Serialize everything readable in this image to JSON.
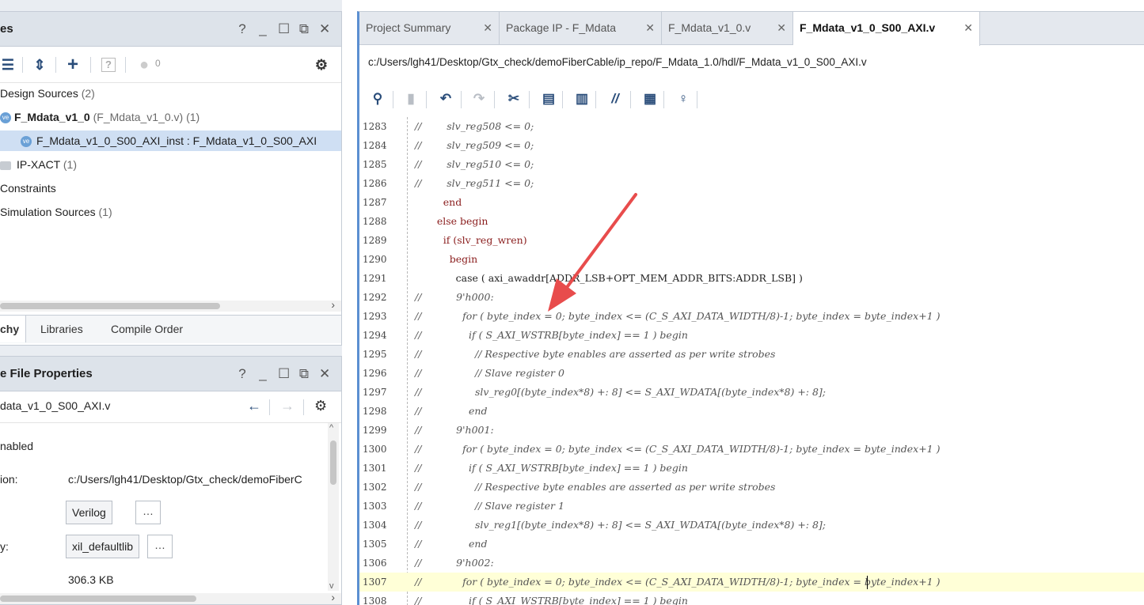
{
  "sources_panel": {
    "title": "es",
    "toolbar_badge": "0",
    "tree": [
      {
        "label": "Design Sources",
        "count": "(2)"
      },
      {
        "label": "F_Mdata_v1_0",
        "detail": "(F_Mdata_v1_0.v) (1)"
      },
      {
        "label": "F_Mdata_v1_0_S00_AXI_inst : F_Mdata_v1_0_S00_AXI"
      },
      {
        "label": "IP-XACT",
        "count": "(1)"
      },
      {
        "label": "Constraints"
      },
      {
        "label": "Simulation Sources",
        "count": "(1)"
      }
    ],
    "tabs": [
      "chy",
      "Libraries",
      "Compile Order"
    ]
  },
  "props_panel": {
    "title": "e File Properties",
    "file": "data_v1_0_S00_AXI.v",
    "enabled": "nabled",
    "location_label": "ion:",
    "location_value": "c:/Users/lgh41/Desktop/Gtx_check/demoFiberC",
    "type_value": "Verilog",
    "library_label": "y:",
    "library_value": "xil_defaultlib",
    "size_value": "306.3 KB"
  },
  "editor": {
    "tabs": [
      {
        "label": "Project Summary"
      },
      {
        "label": "Package IP - F_Mdata"
      },
      {
        "label": "F_Mdata_v1_0.v"
      },
      {
        "label": "F_Mdata_v1_0_S00_AXI.v"
      }
    ],
    "path": "c:/Users/lgh41/Desktop/Gtx_check/demoFiberCable/ip_repo/F_Mdata_1.0/hdl/F_Mdata_v1_0_S00_AXI.v",
    "lines": [
      {
        "n": "1283",
        "c": "//",
        "t": "        slv_reg508 <= 0;"
      },
      {
        "n": "1284",
        "c": "//",
        "t": "        slv_reg509 <= 0;"
      },
      {
        "n": "1285",
        "c": "//",
        "t": "        slv_reg510 <= 0;"
      },
      {
        "n": "1286",
        "c": "//",
        "t": "        slv_reg511 <= 0;"
      },
      {
        "n": "1287",
        "c": "",
        "t": "         end"
      },
      {
        "n": "1288",
        "c": "",
        "t": "       else begin"
      },
      {
        "n": "1289",
        "c": "",
        "t": "         if (slv_reg_wren)"
      },
      {
        "n": "1290",
        "c": "",
        "t": "           begin"
      },
      {
        "n": "1291",
        "c": "",
        "t": "             case ( axi_awaddr[ADDR_LSB+OPT_MEM_ADDR_BITS:ADDR_LSB] )"
      },
      {
        "n": "1292",
        "c": "//",
        "t": "           9'h000:"
      },
      {
        "n": "1293",
        "c": "//",
        "t": "             for ( byte_index = 0; byte_index <= (C_S_AXI_DATA_WIDTH/8)-1; byte_index = byte_index+1 )"
      },
      {
        "n": "1294",
        "c": "//",
        "t": "               if ( S_AXI_WSTRB[byte_index] == 1 ) begin"
      },
      {
        "n": "1295",
        "c": "//",
        "t": "                 // Respective byte enables are asserted as per write strobes"
      },
      {
        "n": "1296",
        "c": "//",
        "t": "                 // Slave register 0"
      },
      {
        "n": "1297",
        "c": "//",
        "t": "                 slv_reg0[(byte_index*8) +: 8] <= S_AXI_WDATA[(byte_index*8) +: 8];"
      },
      {
        "n": "1298",
        "c": "//",
        "t": "               end"
      },
      {
        "n": "1299",
        "c": "//",
        "t": "           9'h001:"
      },
      {
        "n": "1300",
        "c": "//",
        "t": "             for ( byte_index = 0; byte_index <= (C_S_AXI_DATA_WIDTH/8)-1; byte_index = byte_index+1 )"
      },
      {
        "n": "1301",
        "c": "//",
        "t": "               if ( S_AXI_WSTRB[byte_index] == 1 ) begin"
      },
      {
        "n": "1302",
        "c": "//",
        "t": "                 // Respective byte enables are asserted as per write strobes"
      },
      {
        "n": "1303",
        "c": "//",
        "t": "                 // Slave register 1"
      },
      {
        "n": "1304",
        "c": "//",
        "t": "                 slv_reg1[(byte_index*8) +: 8] <= S_AXI_WDATA[(byte_index*8) +: 8];"
      },
      {
        "n": "1305",
        "c": "//",
        "t": "               end"
      },
      {
        "n": "1306",
        "c": "//",
        "t": "           9'h002:"
      },
      {
        "n": "1307",
        "c": "//",
        "t": "             for ( byte_index = 0; byte_index <= (C_S_AXI_DATA_WIDTH/8)-1; byte_index = byte_index+1 )"
      },
      {
        "n": "1308",
        "c": "//",
        "t": "               if ( S_AXI_WSTRB[byte_index] == 1 ) begin"
      }
    ]
  },
  "colors": {
    "accent": "#5b8fd1",
    "keyword": "#8a1d1d",
    "highlight_line": "#ffffd7",
    "annotation_arrow": "#e84c4c"
  }
}
